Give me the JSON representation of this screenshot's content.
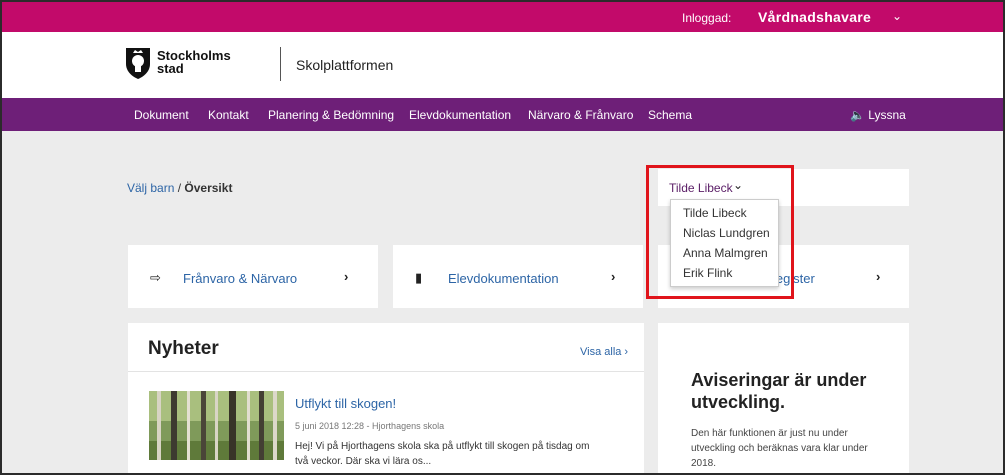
{
  "topbar": {
    "logged_in_label": "Inloggad:",
    "role": "Vårdnadshavare",
    "role_chevron": "⌄"
  },
  "header": {
    "logo_line1": "Stockholms",
    "logo_line2": "stad",
    "platform": "Skolplattformen"
  },
  "nav": {
    "items": [
      "Dokument",
      "Kontakt",
      "Planering & Bedömning",
      "Elevdokumentation",
      "Närvaro & Frånvaro",
      "Schema"
    ],
    "listen": "🔈 Lyssna"
  },
  "breadcrumb": {
    "link": "Välj barn",
    "separator": "/",
    "current": "Översikt"
  },
  "child_selector": {
    "selected": "Tilde Libeck",
    "chevron": "⌄",
    "options": [
      "Tilde Libeck",
      "Niclas Lundgren",
      "Anna Malmgren",
      "Erik Flink"
    ]
  },
  "cards": [
    {
      "icon": "⇨",
      "label": "Frånvaro & Närvaro",
      "chevron": "›"
    },
    {
      "icon": "▮",
      "label": "Elevdokumentation",
      "chevron": "›"
    },
    {
      "label": "...egister",
      "chevron": "›"
    }
  ],
  "news": {
    "title": "Nyheter",
    "view_all": "Visa alla ›",
    "article": {
      "title": "Utflykt till skogen!",
      "meta": "5 juni 2018 12:28 - Hjorthagens skola",
      "text": "Hej! Vi på Hjorthagens skola ska på utflykt till skogen på tisdag om två veckor. Där ska vi lära os..."
    }
  },
  "notice": {
    "title": "Aviseringar är under utveckling.",
    "text": "Den här funktionen är just nu under utveckling och beräknas vara klar under 2018."
  },
  "colors": {
    "topbar": "#c20a6a",
    "nav": "#6e1f78",
    "link": "#2d65a6",
    "highlight": "#e0141b"
  }
}
